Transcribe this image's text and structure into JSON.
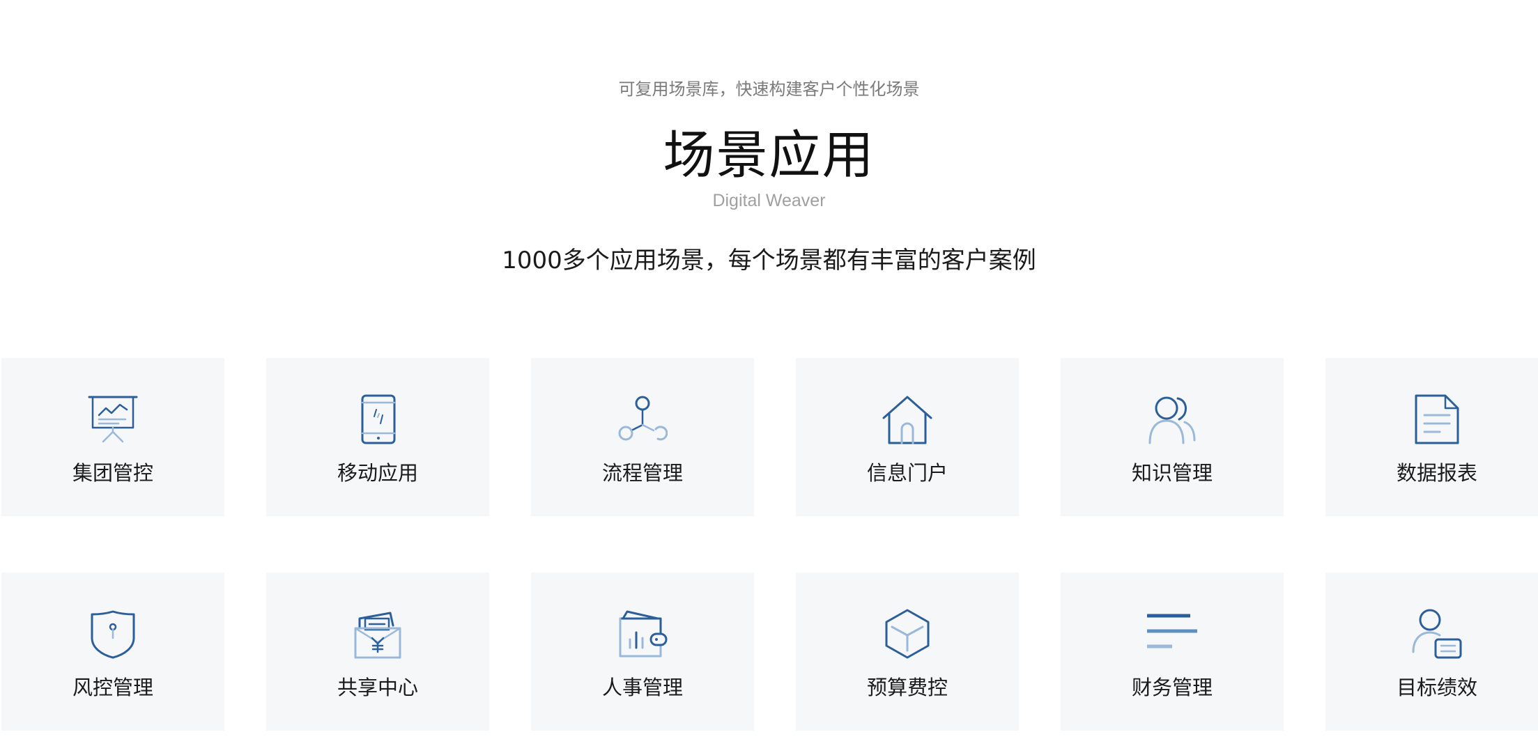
{
  "header": {
    "eyebrow": "可复用场景库，快速构建客户个性化场景",
    "title": "场景应用",
    "subtitle_en": "Digital Weaver",
    "tagline": "1000多个应用场景，每个场景都有丰富的客户案例"
  },
  "colors": {
    "icon_dark": "#2c5f9a",
    "icon_light": "#9ab8d8",
    "card_bg": "#f5f7f9"
  },
  "scenes": [
    {
      "label": "集团管控",
      "icon": "presentation-board-icon"
    },
    {
      "label": "移动应用",
      "icon": "mobile-phone-icon"
    },
    {
      "label": "流程管理",
      "icon": "process-nodes-icon"
    },
    {
      "label": "信息门户",
      "icon": "house-icon"
    },
    {
      "label": "知识管理",
      "icon": "users-icon"
    },
    {
      "label": "数据报表",
      "icon": "document-icon"
    },
    {
      "label": "风控管理",
      "icon": "shield-icon"
    },
    {
      "label": "共享中心",
      "icon": "envelope-yuan-icon"
    },
    {
      "label": "人事管理",
      "icon": "wallet-icon"
    },
    {
      "label": "预算费控",
      "icon": "cube-icon"
    },
    {
      "label": "财务管理",
      "icon": "text-lines-icon"
    },
    {
      "label": "目标绩效",
      "icon": "user-card-icon"
    }
  ]
}
